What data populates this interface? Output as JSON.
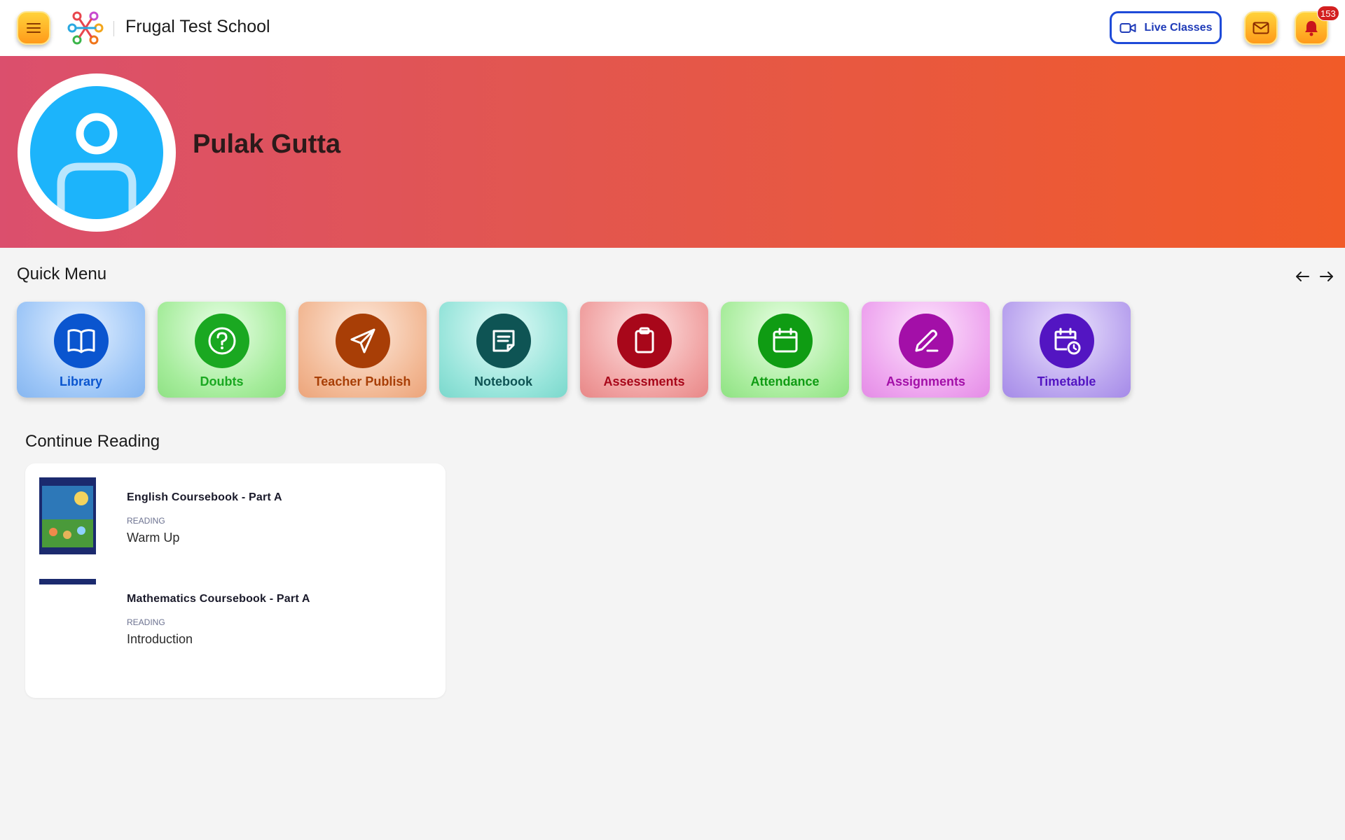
{
  "header": {
    "school_name": "Frugal Test School",
    "live_classes_label": "Live Classes",
    "notification_count": "153",
    "icons": {
      "menu": "hamburger-icon",
      "logo": "school-logo",
      "video": "video-camera-icon",
      "mail": "mail-icon",
      "bell": "bell-icon"
    }
  },
  "profile": {
    "name": "Pulak Gutta"
  },
  "quick_menu": {
    "title": "Quick Menu",
    "items": [
      {
        "label": "Library",
        "icon": "book-open-icon",
        "color": "#0a55cf"
      },
      {
        "label": "Doubts",
        "icon": "question-circle-icon",
        "color": "#1aa821"
      },
      {
        "label": "Teacher Publish",
        "icon": "send-icon",
        "color": "#a83e06"
      },
      {
        "label": "Notebook",
        "icon": "notebook-icon",
        "color": "#0e5454"
      },
      {
        "label": "Assessments",
        "icon": "clipboard-icon",
        "color": "#a8071a"
      },
      {
        "label": "Attendance",
        "icon": "calendar-icon",
        "color": "#0f9c13"
      },
      {
        "label": "Assignments",
        "icon": "pencil-icon",
        "color": "#a30fa8"
      },
      {
        "label": "Timetable",
        "icon": "calendar-clock-icon",
        "color": "#5315c2"
      }
    ]
  },
  "continue_reading": {
    "title": "Continue Reading",
    "books": [
      {
        "title": "English Coursebook - Part A",
        "kind": "READING",
        "chapter": "Warm Up"
      },
      {
        "title": "Mathematics Coursebook - Part A",
        "kind": "READING",
        "chapter": "Introduction"
      }
    ]
  }
}
